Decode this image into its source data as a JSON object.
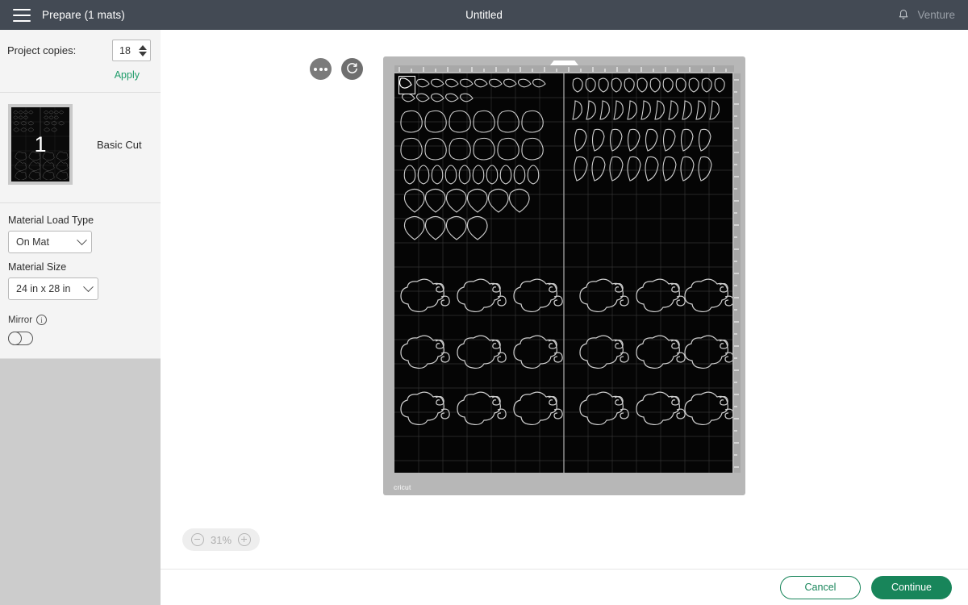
{
  "topbar": {
    "menu_icon": "hamburger-icon",
    "screen_title": "Prepare (1 mats)",
    "document_title": "Untitled",
    "bell_icon": "bell-icon",
    "account_name": "Venture"
  },
  "sidebar": {
    "copies": {
      "label": "Project copies:",
      "value": "18",
      "apply_label": "Apply"
    },
    "mat": {
      "number": "1",
      "label": "Basic Cut"
    },
    "material_load_type": {
      "label": "Material Load Type",
      "value": "On Mat"
    },
    "material_size": {
      "label": "Material Size",
      "value": "24 in x 28 in"
    },
    "mirror": {
      "label": "Mirror",
      "info_icon": "info-icon",
      "enabled": false
    }
  },
  "canvas": {
    "more_options_icon": "ellipsis-icon",
    "rotate_icon": "rotate-icon",
    "brand_label": "cricut",
    "zoom": {
      "minus_icon": "zoom-out-icon",
      "plus_icon": "zoom-in-icon",
      "level": "31%"
    }
  },
  "footer": {
    "cancel_label": "Cancel",
    "continue_label": "Continue"
  },
  "colors": {
    "topbar": "#434a54",
    "sidebar_panel": "#f4f4f4",
    "sidebar_base": "#cccccc",
    "accent_green": "#18855a",
    "apply_green": "#1f9c6a",
    "mat_board": "#b7b7b7",
    "mat_surface": "#050505"
  }
}
